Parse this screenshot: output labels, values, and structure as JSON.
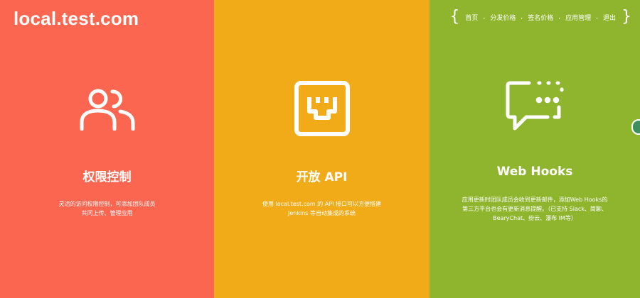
{
  "header": {
    "logo": "local.test.com",
    "nav_open": "{",
    "nav_close": "}",
    "nav_items": [
      "首页",
      "分发价格",
      "签名价格",
      "应用管理",
      "退出"
    ],
    "nav_separator": ","
  },
  "features": [
    {
      "icon": "users-icon",
      "title": "权限控制",
      "desc_line1": "灵活的访问权限控制，可添加团队成员",
      "desc_line2": "共同上传、管理应用",
      "color": "#fa664f"
    },
    {
      "icon": "ethernet-port-icon",
      "title": "开放 API",
      "desc_line1": "使用 local.test.com 的 API 接口可以方便搭建",
      "desc_line2": "Jenkins 等自动集成的系统",
      "color": "#f1ab19"
    },
    {
      "icon": "chat-bubble-icon",
      "title": "Web Hooks",
      "desc_line1": "应用更新时团队成员会收到更新邮件，添加Web Hooks的",
      "desc_line2": "第三方平台也会有更新消息提醒。（已支持 Slack、简聊、",
      "desc_line3": "BearyChat、纷云、瀑布 IM等）",
      "color": "#8fb52f"
    }
  ]
}
